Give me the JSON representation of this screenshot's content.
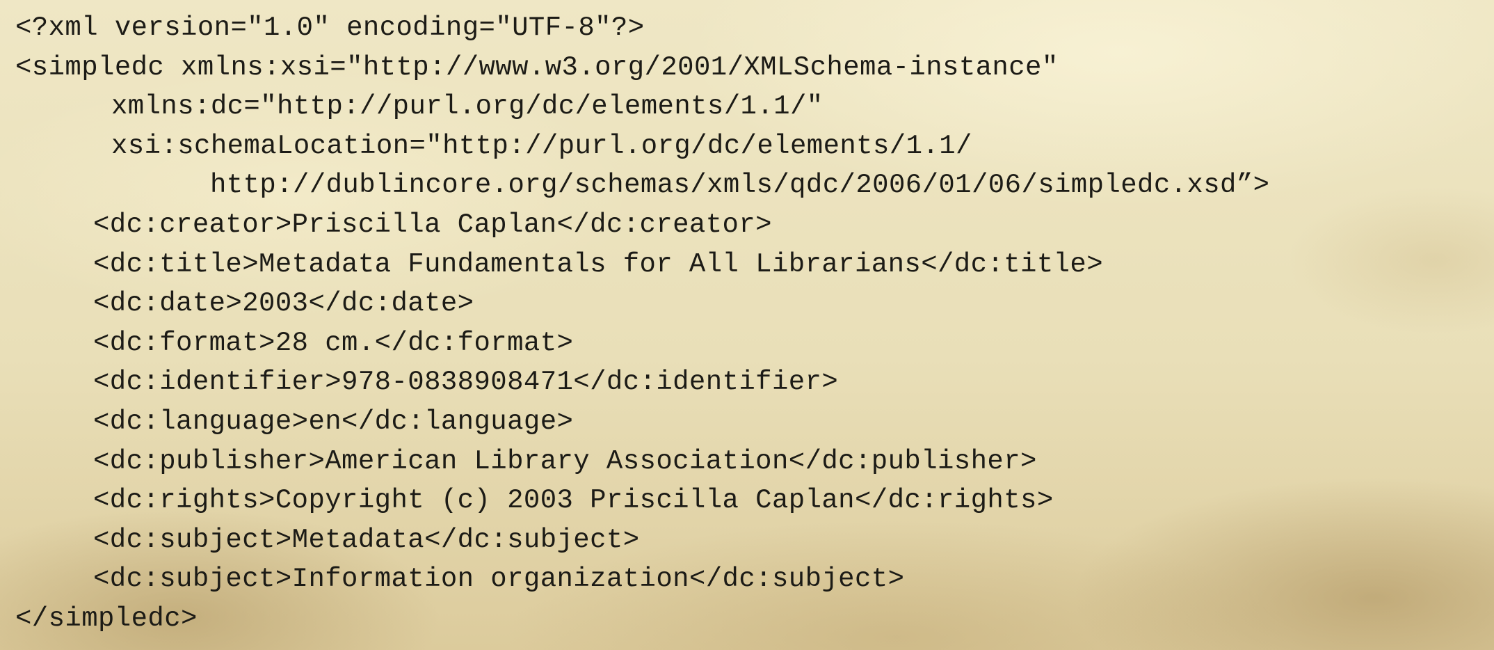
{
  "xml_listing": {
    "lines": [
      "<?xml version=\"1.0\" encoding=\"UTF-8\"?>",
      "<simpledc xmlns:xsi=\"http://www.w3.org/2001/XMLSchema-instance\"",
      "xmlns:dc=\"http://purl.org/dc/elements/1.1/\"",
      "xsi:schemaLocation=\"http://purl.org/dc/elements/1.1/",
      "http://dublincore.org/schemas/xmls/qdc/2006/01/06/simpledc.xsd”>",
      "<dc:creator>Priscilla Caplan</dc:creator>",
      "<dc:title>Metadata Fundamentals for All Librarians</dc:title>",
      "<dc:date>2003</dc:date>",
      "<dc:format>28 cm.</dc:format>",
      "<dc:identifier>978-0838908471</dc:identifier>",
      "<dc:language>en</dc:language>",
      "<dc:publisher>American Library Association</dc:publisher>",
      "<dc:rights>Copyright (c) 2003 Priscilla Caplan</dc:rights>",
      "<dc:subject>Metadata</dc:subject>",
      "<dc:subject>Information organization</dc:subject>",
      "</simpledc>"
    ]
  }
}
